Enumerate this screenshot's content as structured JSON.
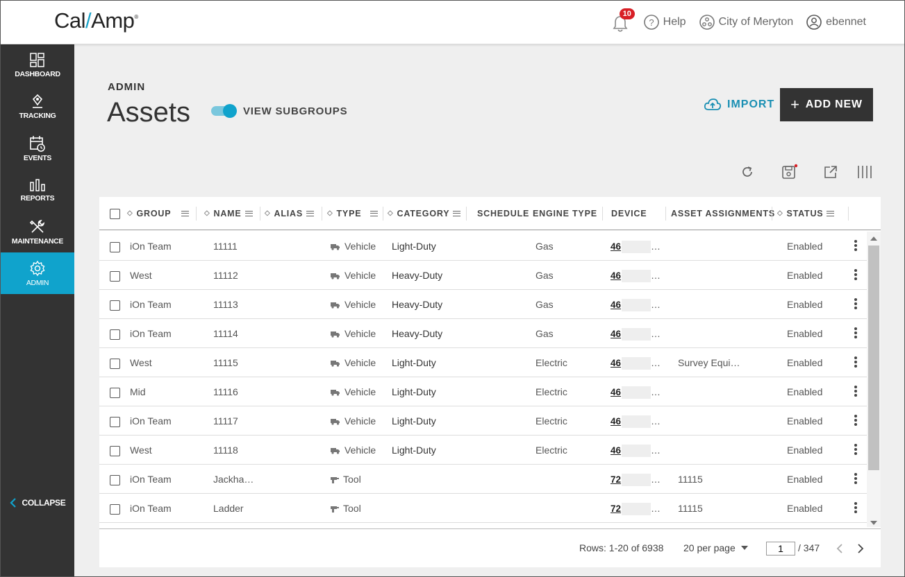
{
  "header": {
    "logo_text": "Cal/Amp",
    "notification_count": "10",
    "help_label": "Help",
    "org_label": "City of Meryton",
    "user_label": "ebennet"
  },
  "sidebar": {
    "items": [
      {
        "label": "DASHBOARD",
        "icon": "dashboard-icon"
      },
      {
        "label": "TRACKING",
        "icon": "tracking-pin-icon"
      },
      {
        "label": "EVENTS",
        "icon": "events-calendar-icon"
      },
      {
        "label": "REPORTS",
        "icon": "reports-bars-icon"
      },
      {
        "label": "MAINTENANCE",
        "icon": "maintenance-tools-icon"
      },
      {
        "label": "ADMIN",
        "icon": "admin-gear-icon",
        "active": true
      }
    ],
    "collapse_label": "COLLAPSE"
  },
  "page": {
    "kicker": "ADMIN",
    "title": "Assets",
    "toggle_label": "VIEW SUBGROUPS",
    "toggle_on": true,
    "import_label": "IMPORT",
    "add_new_label": "ADD NEW"
  },
  "table": {
    "columns": [
      "GROUP",
      "NAME",
      "ALIAS",
      "TYPE",
      "CATEGORY",
      "SCHEDULE",
      "ENGINE TYPE",
      "DEVICE",
      "ASSET ASSIGNMENTS",
      "STATUS"
    ],
    "rows": [
      {
        "group": "iOn Team",
        "name": "11111",
        "type": "Vehicle",
        "category": "Light-Duty",
        "engine": "Gas",
        "device": "46",
        "assign": "",
        "status": "Enabled"
      },
      {
        "group": "West",
        "name": "11112",
        "type": "Vehicle",
        "category": "Heavy-Duty",
        "engine": "Gas",
        "device": "46",
        "assign": "",
        "status": "Enabled"
      },
      {
        "group": "iOn Team",
        "name": "11113",
        "type": "Vehicle",
        "category": "Heavy-Duty",
        "engine": "Gas",
        "device": "46",
        "assign": "",
        "status": "Enabled"
      },
      {
        "group": "iOn Team",
        "name": "11114",
        "type": "Vehicle",
        "category": "Heavy-Duty",
        "engine": "Gas",
        "device": "46",
        "assign": "",
        "status": "Enabled"
      },
      {
        "group": "West",
        "name": "11115",
        "type": "Vehicle",
        "category": "Light-Duty",
        "engine": "Electric",
        "device": "46",
        "assign": "Survey Equi…",
        "status": "Enabled"
      },
      {
        "group": "Mid",
        "name": "11116",
        "type": "Vehicle",
        "category": "Light-Duty",
        "engine": "Electric",
        "device": "46",
        "assign": "",
        "status": "Enabled"
      },
      {
        "group": "iOn Team",
        "name": "11117",
        "type": "Vehicle",
        "category": "Light-Duty",
        "engine": "Electric",
        "device": "46",
        "assign": "",
        "status": "Enabled"
      },
      {
        "group": "West",
        "name": "11118",
        "type": "Vehicle",
        "category": "Light-Duty",
        "engine": "Electric",
        "device": "46",
        "assign": "",
        "status": "Enabled"
      },
      {
        "group": "iOn Team",
        "name": "Jackha…",
        "type": "Tool",
        "category": "",
        "engine": "",
        "device": "72",
        "assign": "11115",
        "status": "Enabled"
      },
      {
        "group": "iOn Team",
        "name": "Ladder",
        "type": "Tool",
        "category": "",
        "engine": "",
        "device": "72",
        "assign": "11115",
        "status": "Enabled"
      }
    ]
  },
  "footer": {
    "rows_label": "Rows: 1-20 of 6938",
    "per_page": "20 per page",
    "page_value": "1",
    "page_total": "/ 347"
  },
  "colors": {
    "accent": "#10a3cc",
    "sidebar_bg": "#333333",
    "badge": "#d81f26"
  }
}
